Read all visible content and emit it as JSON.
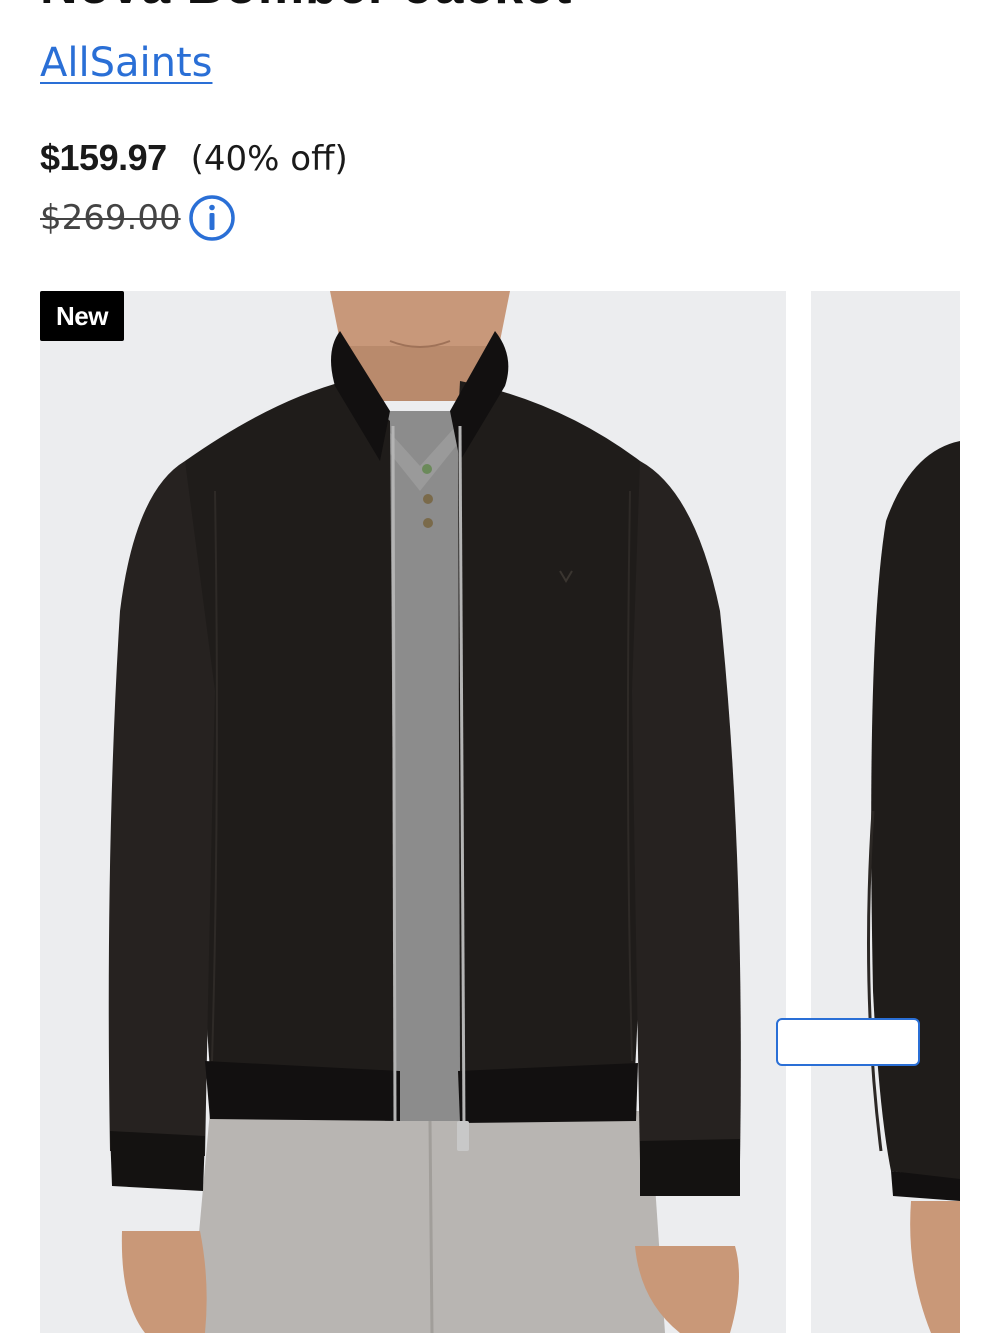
{
  "product": {
    "title": "Nova Bomber Jacket",
    "brand": "AllSaints",
    "price": "$159.97",
    "discount": "(40% off)",
    "original_price": "$269.00",
    "badge": "New"
  },
  "icons": {
    "info": "info-circle-icon"
  },
  "colors": {
    "brand_link": "#2a6fd6",
    "info_icon": "#2a6fd6",
    "badge_bg": "#000000",
    "image_bg": "#ecedef"
  }
}
